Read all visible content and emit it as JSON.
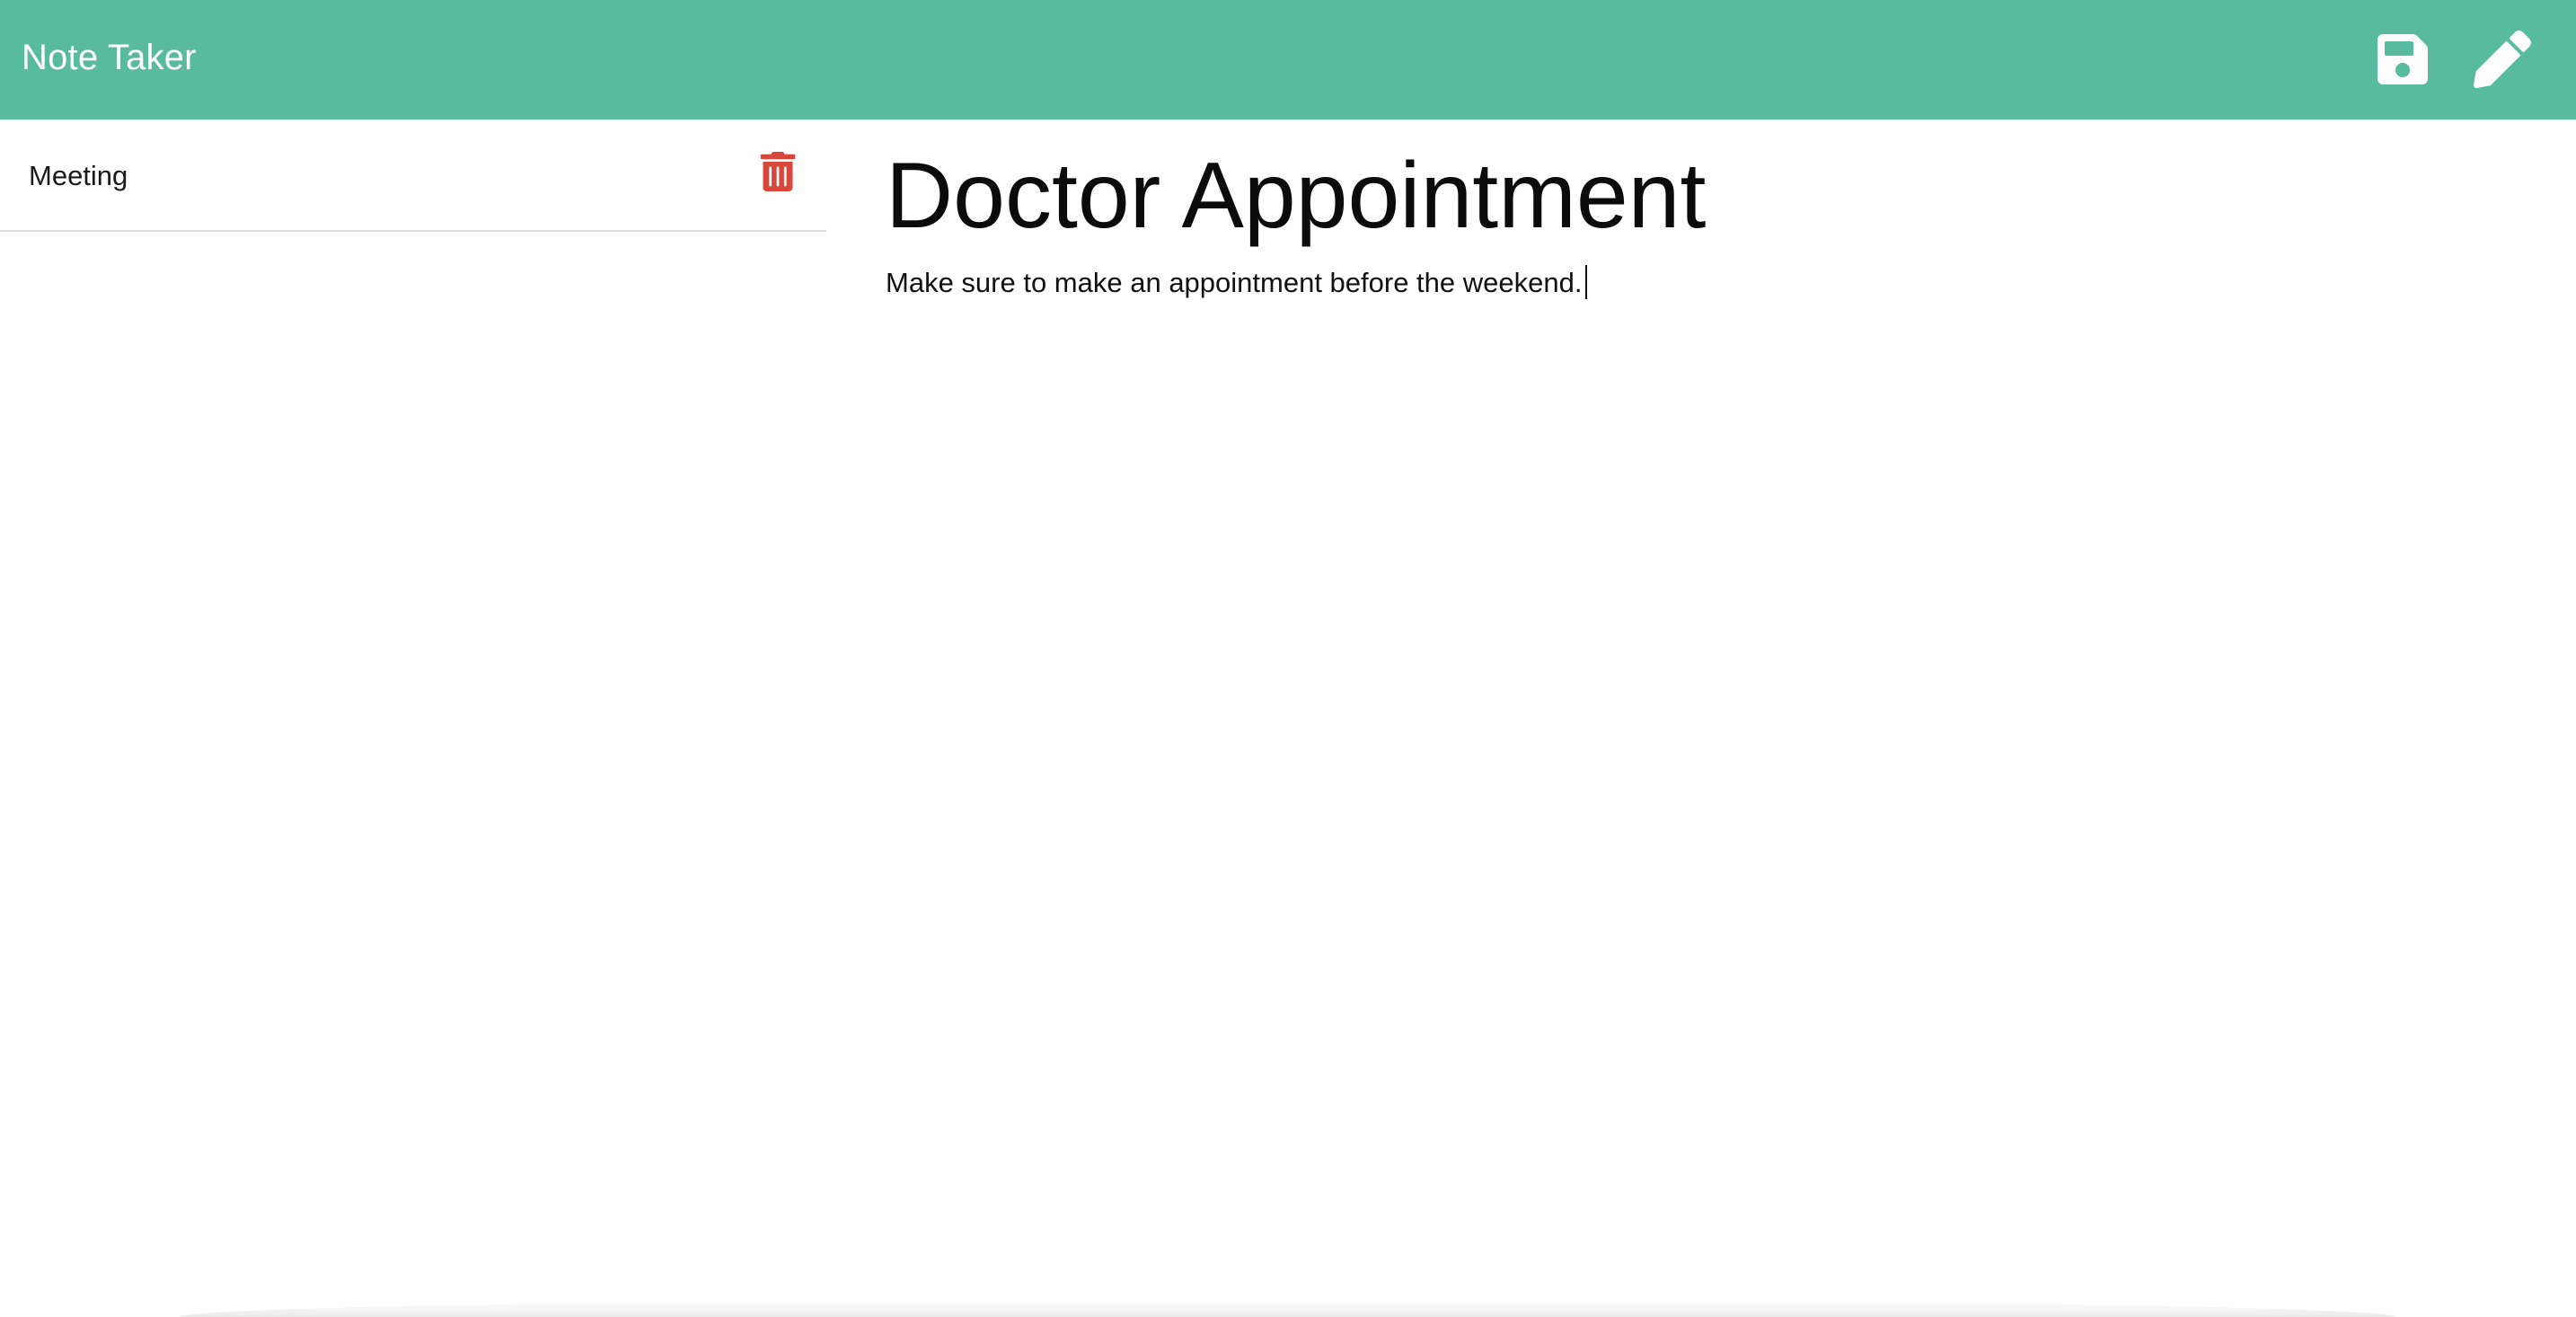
{
  "app": {
    "title": "Note Taker",
    "accent_color": "#58bb9e",
    "delete_color": "#d9463a"
  },
  "toolbar": {
    "save_icon": "save-icon",
    "new_note_icon": "pencil-icon"
  },
  "sidebar": {
    "notes": [
      {
        "label": "Meeting",
        "icon": "trash-icon"
      }
    ]
  },
  "editor": {
    "title": "Doctor Appointment",
    "body": "Make sure to make an appointment before the weekend."
  }
}
